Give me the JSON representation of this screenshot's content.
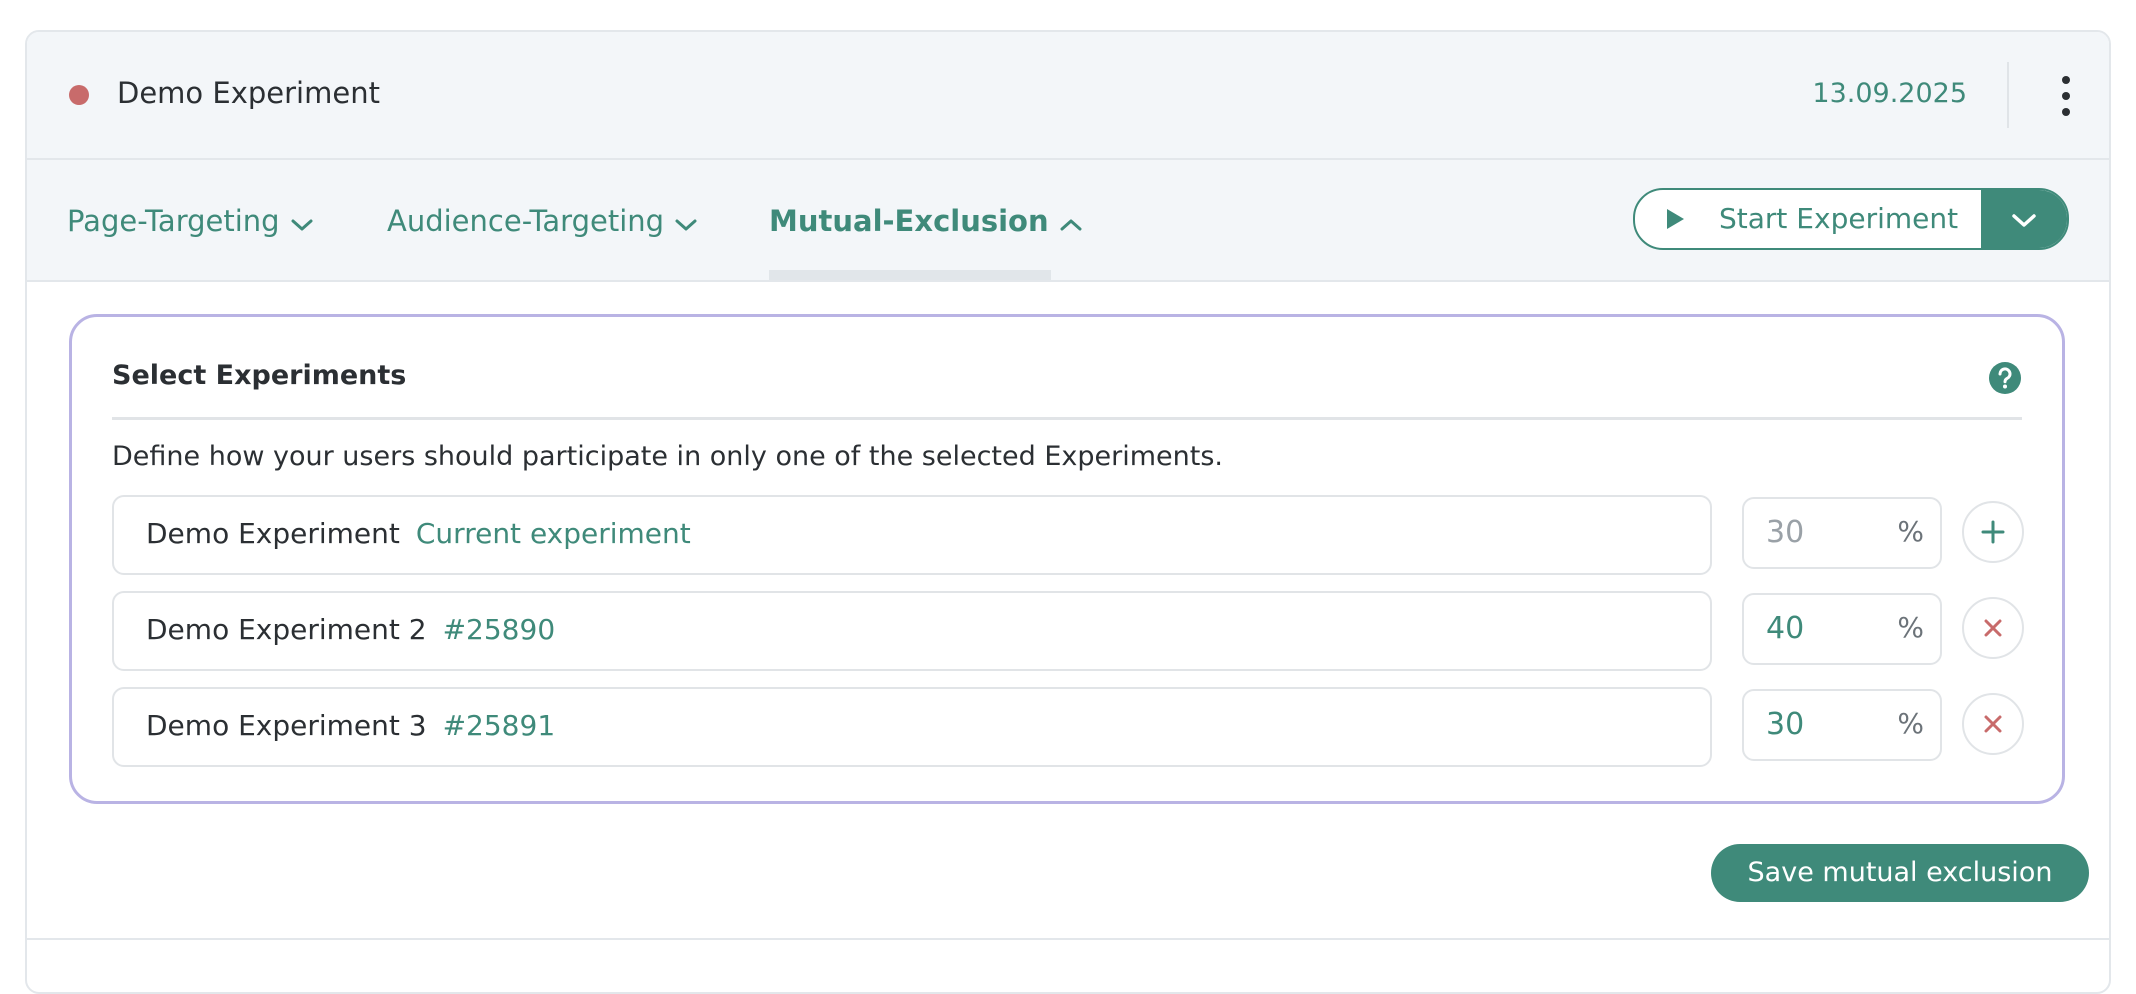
{
  "header": {
    "title": "Demo Experiment",
    "date": "13.09.2025",
    "status_color": "#c86b6b",
    "menu_icon": "kebab-menu-icon"
  },
  "nav": {
    "tabs": [
      {
        "label": "Page-Targeting",
        "icon": "chevron-down-icon"
      },
      {
        "label": "Audience-Targeting",
        "icon": "chevron-down-icon"
      },
      {
        "label": "Mutual-Exclusion",
        "icon": "chevron-up-icon",
        "active": true
      }
    ],
    "start_button": {
      "label": "Start Experiment",
      "icon": "play-icon",
      "dropdown_icon": "chevron-down-icon"
    }
  },
  "panel": {
    "title": "Select Experiments",
    "help_icon": "help-icon",
    "description": "Define how your users should participate in only one of the selected Experiments.",
    "rows": [
      {
        "name": "Demo Experiment",
        "tag": "Current experiment",
        "percent": "30",
        "unit": "%",
        "action": "add"
      },
      {
        "name": "Demo Experiment 2",
        "tag": "#25890",
        "percent": "40",
        "unit": "%",
        "action": "remove"
      },
      {
        "name": "Demo Experiment 3",
        "tag": "#25891",
        "percent": "30",
        "unit": "%",
        "action": "remove"
      }
    ]
  },
  "save_button": {
    "label": "Save mutual exclusion"
  },
  "colors": {
    "accent": "#3f8a7a",
    "panel_border": "#b9b3e4",
    "remove": "#c86b6b",
    "header_bg": "#f3f6f9"
  }
}
